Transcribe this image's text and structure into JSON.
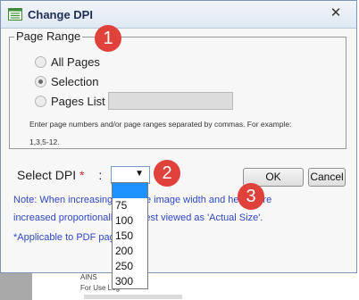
{
  "dialog": {
    "title": "Change DPI",
    "close_glyph": "✕"
  },
  "page_range": {
    "legend": "Page Range",
    "options": [
      {
        "label": "All Pages",
        "checked": false
      },
      {
        "label": "Selection",
        "checked": true
      },
      {
        "label": "Pages List",
        "checked": false
      }
    ],
    "pages_list_value": "",
    "hint_line1": "Enter page numbers and/or page ranges separated by commas. For example:",
    "hint_line2": "1,3,5-12."
  },
  "dpi": {
    "label": "Select DPI",
    "required_mark": "*",
    "colon": ":",
    "arrow": "▼",
    "selected_value": "",
    "options": [
      "",
      "75",
      "100",
      "150",
      "200",
      "250",
      "300"
    ]
  },
  "buttons": {
    "ok": "OK",
    "cancel": "Cancel"
  },
  "notes": {
    "line1": "Note: When increasing DPI, the image width and height are",
    "line2": "increased proportionally and best viewed as 'Actual Size'.",
    "line3": "*Applicable to PDF pages only."
  },
  "callouts": [
    "1",
    "2",
    "3"
  ],
  "background_page": {
    "text1": "AINS",
    "text2": "For Use Log"
  },
  "colors": {
    "accent": "#1e90ff",
    "note_text": "#2f49c9",
    "callout": "#e0413a",
    "required": "#d32f2f"
  },
  "icons": {
    "title": "window-list-icon",
    "close": "close-icon",
    "dropdown": "chevron-down-icon"
  }
}
